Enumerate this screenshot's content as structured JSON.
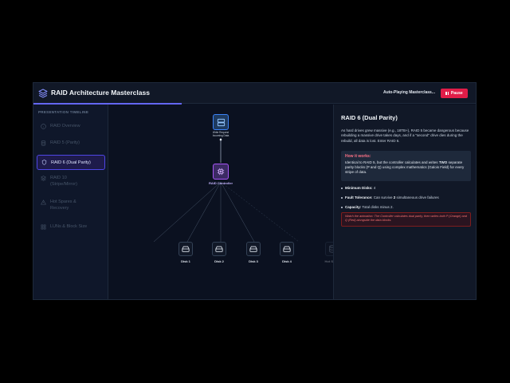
{
  "header": {
    "title": "RAID Architecture Masterclass",
    "status": "Auto-Playing Masterclass...",
    "pause_label": "Pause"
  },
  "sidebar": {
    "title": "PRESENTATION TIMELINE",
    "items": [
      {
        "label": "RAID Overview",
        "icon": "info-icon"
      },
      {
        "label": "RAID 5 (Parity)",
        "icon": "database-icon"
      },
      {
        "label": "RAID 6 (Dual Parity)",
        "icon": "shield-icon",
        "active": true
      },
      {
        "label": "RAID 10 (Stripe/Mirror)",
        "icon": "layers-icon"
      },
      {
        "label": "Hot Spares & Recovery",
        "icon": "alert-icon"
      },
      {
        "label": "LUNs & Block Size",
        "icon": "grid-icon"
      }
    ]
  },
  "diagram": {
    "server_label": "Write Request Incoming Data",
    "controller_label": "RAID Controller",
    "disks": [
      "Disk 1",
      "Disk 2",
      "Disk 3",
      "Disk 4"
    ],
    "spare_label": "Hot Spare"
  },
  "panel": {
    "title": "RAID 6 (Dual Parity)",
    "intro": "As hard drives grew massive (e.g., 18TB+), RAID 5 became dangerous because rebuilding a massive drive takes days, and if a \"second\" drive dies during the rebuild, all data is lost. Enter RAID 6.",
    "how_heading": "How it works:",
    "how_text_1": "Identical to RAID 5, but the controller calculates and writes ",
    "how_bold": "TWO",
    "how_text_2": " separate parity blocks (P and Q) using complex mathematics (Galois Field) for every stripe of data.",
    "bullets": [
      {
        "label": "Minimum Disks:",
        "value": " 4"
      },
      {
        "label": "Fault Tolerance:",
        "value": " Can survive ",
        "bold": "2",
        "value2": " simultaneous drive failures"
      },
      {
        "label": "Capacity:",
        "value": " Total disks minus 2."
      }
    ],
    "note": "Watch the animation: The Controller calculates dual parity, then writes both P (Orange) and Q (Red) alongside the data blocks."
  },
  "colors": {
    "accent": "#6366f1",
    "pause": "#e11d48",
    "controller": "#a855f7",
    "server": "#3b82f6",
    "note": "#f87171"
  }
}
